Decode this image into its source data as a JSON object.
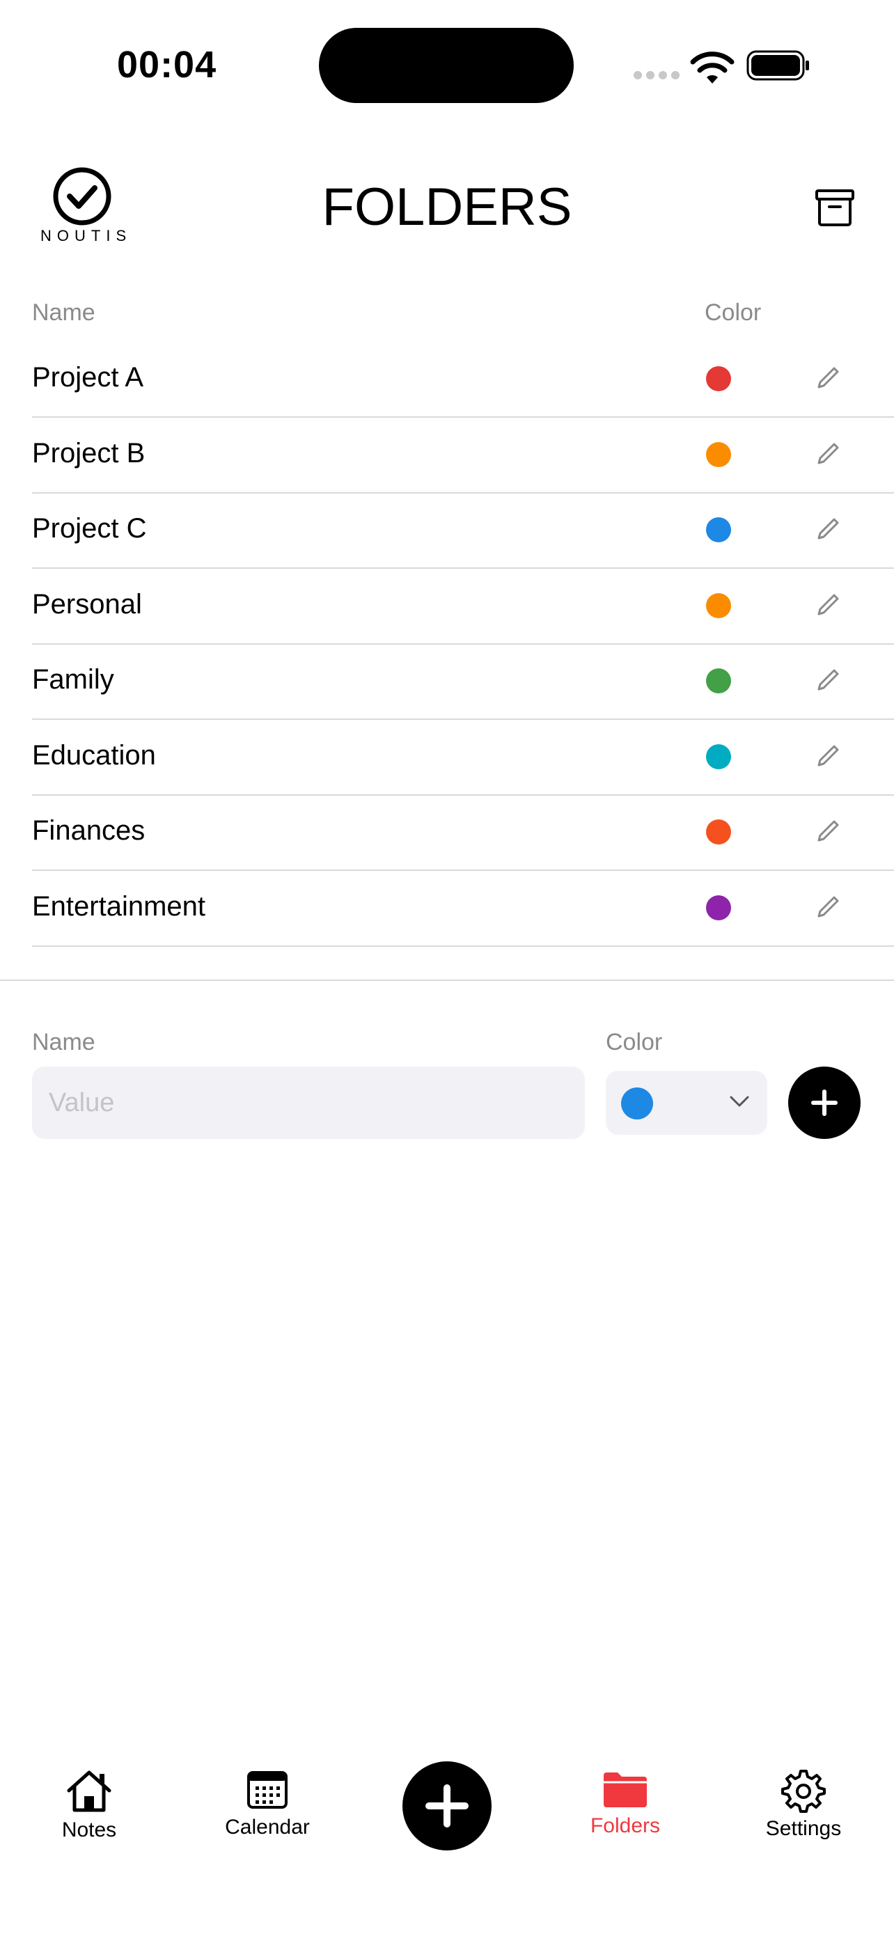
{
  "status_bar": {
    "time": "00:04"
  },
  "header": {
    "logo_text": "NOUTIS",
    "title": "FOLDERS"
  },
  "table": {
    "name_header": "Name",
    "color_header": "Color",
    "rows": [
      {
        "name": "Project A",
        "color": "#e53935"
      },
      {
        "name": "Project B",
        "color": "#fb8c00"
      },
      {
        "name": "Project C",
        "color": "#1e88e5"
      },
      {
        "name": "Personal",
        "color": "#fb8c00"
      },
      {
        "name": "Family",
        "color": "#43a047"
      },
      {
        "name": "Education",
        "color": "#00acc1"
      },
      {
        "name": "Finances",
        "color": "#f4511e"
      },
      {
        "name": "Entertainment",
        "color": "#8e24aa"
      }
    ]
  },
  "add_form": {
    "name_label": "Name",
    "name_placeholder": "Value",
    "name_value": "",
    "color_label": "Color",
    "selected_color": "#1e88e5"
  },
  "tab_bar": {
    "active_color": "#f0383f",
    "items": [
      {
        "label": "Notes",
        "icon": "home-icon"
      },
      {
        "label": "Calendar",
        "icon": "calendar-icon"
      },
      {
        "label": "Folders",
        "icon": "folder-icon"
      },
      {
        "label": "Settings",
        "icon": "gear-icon"
      }
    ]
  }
}
